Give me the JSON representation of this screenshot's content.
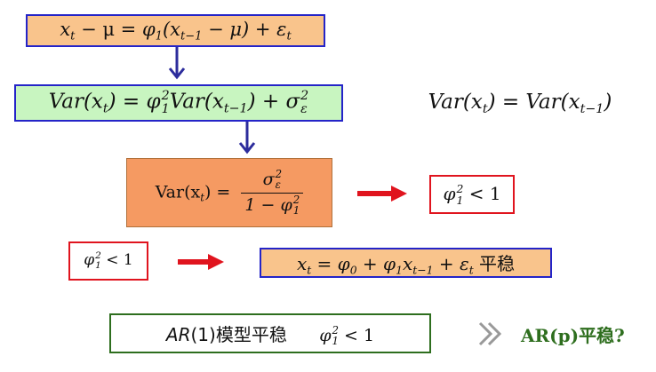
{
  "eq_top": {
    "lhs": "x",
    "lhs_sub": "t",
    "minus_mu": " − μ = ",
    "phi": "φ",
    "phi_sub": "1",
    "paren_open": "(x",
    "x_sub": "t−1",
    "minus_mu2": " − μ) + ε",
    "eps_sub": "t"
  },
  "eq_var": {
    "text_a": "Var(x",
    "sub_a": "t",
    "text_b": ") = φ",
    "sup_b": "2",
    "sub_b": "1",
    "text_c": "Var(x",
    "sub_c": "t−1",
    "text_d": ") + σ",
    "sup_d": "2",
    "sub_d": "ε"
  },
  "eq_stationary": {
    "text_a": "Var(x",
    "sub_a": "t",
    "text_b": ") = Var(x",
    "sub_b": "t−1",
    "text_c": ")"
  },
  "eq_result": {
    "lhs_a": "Var(x",
    "lhs_sub": "t",
    "lhs_b": ") =",
    "num_a": "σ",
    "num_sup": "2",
    "num_sub": "ε",
    "den_a": "1 − φ",
    "den_sup": "2",
    "den_sub": "1"
  },
  "cond_right": {
    "phi": "φ",
    "sup": "2",
    "sub": "1",
    "rest": " < 1"
  },
  "cond_left": {
    "phi": "φ",
    "sup": "2",
    "sub": "1",
    "rest": " < 1"
  },
  "eq_ar1": {
    "a": "x",
    "a_sub": "t",
    "b": " = φ",
    "b_sub": "0",
    "c": " + φ",
    "c_sub": "1",
    "d": "x",
    "d_sub": "t−1",
    "e": " + ε",
    "e_sub": "t",
    "label": " 平稳"
  },
  "summary": {
    "model": "AR",
    "model_paren": "(1)模型平稳",
    "phi": "φ",
    "sup": "2",
    "sub": "1",
    "rest": " < 1"
  },
  "question": "AR(p)平稳?",
  "colors": {
    "box1_fill": "#f9c48c",
    "box2_fill": "#c8f5c0",
    "box3_fill": "#f59a62",
    "box4_fill": "#f9c48c",
    "blue_border": "#2424c8",
    "red": "#e0141e",
    "green_text": "#2e6e1e",
    "arrow_blue": "#2c2c9c"
  }
}
